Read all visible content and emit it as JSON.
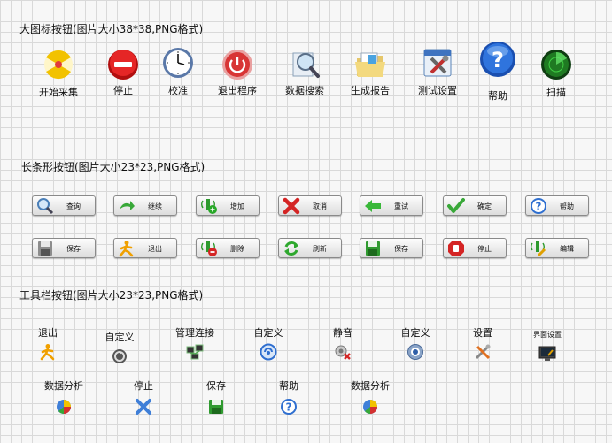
{
  "sections": {
    "large": "大图标按钮(图片大小38*38,PNG格式)",
    "long": "长条形按钮(图片大小23*23,PNG格式)",
    "toolbar": "工具栏按钮(图片大小23*23,PNG格式)"
  },
  "large_buttons": [
    {
      "label": "开始采集",
      "icon": "radiation-icon"
    },
    {
      "label": "停止",
      "icon": "stop-icon"
    },
    {
      "label": "校准",
      "icon": "clock-icon"
    },
    {
      "label": "退出程序",
      "icon": "power-icon"
    },
    {
      "label": "数据搜索",
      "icon": "magnifier-icon"
    },
    {
      "label": "生成报告",
      "icon": "folder-icon"
    },
    {
      "label": "测试设置",
      "icon": "tools-icon"
    },
    {
      "label": "帮助",
      "icon": "help-icon"
    },
    {
      "label": "扫描",
      "icon": "radar-icon"
    }
  ],
  "long_buttons_row1": [
    {
      "label": "查询",
      "icon": "search-icon"
    },
    {
      "label": "继续",
      "icon": "continue-arrow-icon"
    },
    {
      "label": "增加",
      "icon": "add-icon"
    },
    {
      "label": "取消",
      "icon": "cancel-icon"
    },
    {
      "label": "重试",
      "icon": "back-arrow-icon"
    },
    {
      "label": "确定",
      "icon": "check-icon"
    },
    {
      "label": "帮助",
      "icon": "help-icon"
    }
  ],
  "long_buttons_row2": [
    {
      "label": "保存",
      "icon": "floppy-gray-icon"
    },
    {
      "label": "退出",
      "icon": "exit-man-icon"
    },
    {
      "label": "删除",
      "icon": "delete-icon"
    },
    {
      "label": "刷新",
      "icon": "refresh-icon"
    },
    {
      "label": "保存",
      "icon": "floppy-green-icon"
    },
    {
      "label": "停止",
      "icon": "stop-hand-icon"
    },
    {
      "label": "编辑",
      "icon": "edit-icon"
    }
  ],
  "toolbar_row1": [
    {
      "label": "退出",
      "icon": "exit-man-icon"
    },
    {
      "label": "自定义",
      "icon": "custom-gear-icon"
    },
    {
      "label": "管理连接",
      "icon": "network-icon"
    },
    {
      "label": "自定义",
      "icon": "custom-blue-icon"
    },
    {
      "label": "静音",
      "icon": "mute-icon"
    },
    {
      "label": "自定义",
      "icon": "custom-webcam-icon"
    },
    {
      "label": "设置",
      "icon": "settings-tools-icon"
    },
    {
      "label": "界面设置",
      "icon": "monitor-settings-icon"
    }
  ],
  "toolbar_row2": [
    {
      "label": "数据分析",
      "icon": "pie-chart-icon"
    },
    {
      "label": "停止",
      "icon": "stop-x-icon"
    },
    {
      "label": "保存",
      "icon": "floppy-green-icon"
    },
    {
      "label": "帮助",
      "icon": "help-icon"
    },
    {
      "label": "数据分析",
      "icon": "pie-chart-icon"
    }
  ]
}
